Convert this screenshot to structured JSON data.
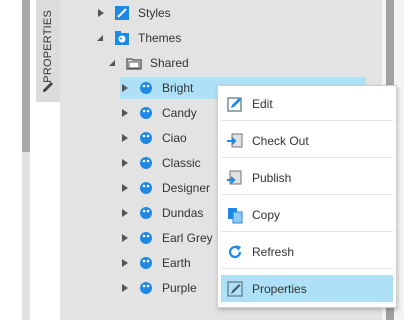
{
  "side_tab": {
    "label": "PROPERTIES",
    "icon": "pencil-icon"
  },
  "tree": {
    "items": [
      {
        "label": "Styles",
        "icon": "styles-icon",
        "expanded": false
      },
      {
        "label": "Themes",
        "icon": "themes-icon",
        "expanded": true
      },
      {
        "label": "Shared",
        "icon": "folder-icon",
        "expanded": true
      },
      {
        "label": "Bright",
        "icon": "theme-icon",
        "expanded": false,
        "selected": true
      },
      {
        "label": "Candy",
        "icon": "theme-icon",
        "expanded": false
      },
      {
        "label": "Ciao",
        "icon": "theme-icon",
        "expanded": false
      },
      {
        "label": "Classic",
        "icon": "theme-icon",
        "expanded": false
      },
      {
        "label": "Designer",
        "icon": "theme-icon",
        "expanded": false
      },
      {
        "label": "Dundas",
        "icon": "theme-icon",
        "expanded": false
      },
      {
        "label": "Earl Grey",
        "icon": "theme-icon",
        "expanded": false
      },
      {
        "label": "Earth",
        "icon": "theme-icon",
        "expanded": false
      },
      {
        "label": "Purple",
        "icon": "theme-icon",
        "expanded": false
      }
    ]
  },
  "context_menu": {
    "items": [
      {
        "label": "Edit",
        "icon": "edit-icon"
      },
      {
        "label": "Check Out",
        "icon": "check-out-icon"
      },
      {
        "label": "Publish",
        "icon": "publish-icon"
      },
      {
        "label": "Copy",
        "icon": "copy-icon"
      },
      {
        "label": "Refresh",
        "icon": "refresh-icon"
      },
      {
        "label": "Properties",
        "icon": "properties-icon",
        "highlighted": true
      }
    ]
  },
  "colors": {
    "selection": "#aee0f7",
    "accent_blue": "#1e88e5"
  }
}
